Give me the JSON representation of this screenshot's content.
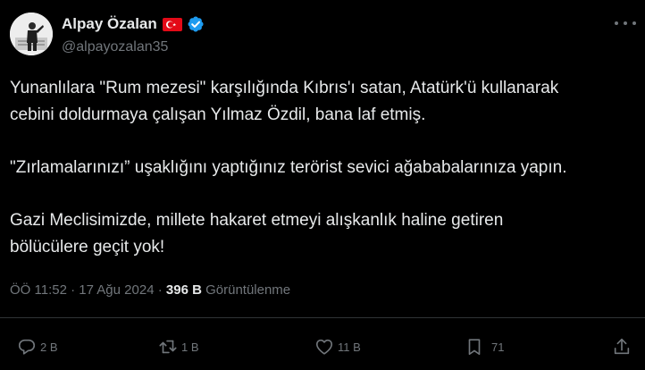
{
  "author": {
    "name": "Alpay Özalan",
    "handle": "@alpayozalan35"
  },
  "post": {
    "paragraphs": [
      "Yunanlılara \"Rum mezesi\" karşılığında Kıbrıs'ı satan, Atatürk'ü kullanarak\ncebini doldurmaya çalışan Yılmaz Özdil, bana laf etmiş.",
      "\"Zırlamalarınızı” uşaklığını yaptığınız terörist sevici ağababalarınıza yapın.",
      "Gazi Meclisimizde, millete hakaret etmeyi alışkanlık haline getiren\nbölücülere geçit yok!"
    ],
    "time": "ÖÖ 11:52",
    "separator": "·",
    "date": "17 Ağu 2024",
    "views_count": "396 B",
    "views_label": "Görüntülenme"
  },
  "actions": {
    "replies": "2 B",
    "reposts": "1 B",
    "likes": "11 B",
    "bookmarks": "71"
  },
  "colors": {
    "background": "#000000",
    "text": "#e7e9ea",
    "secondary": "#71767b",
    "verified": "#1d9bf0",
    "flag": "#e30a17"
  },
  "icons": [
    "turkey-flag-icon",
    "verified-badge-icon",
    "more-options-icon",
    "reply-icon",
    "repost-icon",
    "like-icon",
    "bookmark-icon",
    "share-icon"
  ]
}
